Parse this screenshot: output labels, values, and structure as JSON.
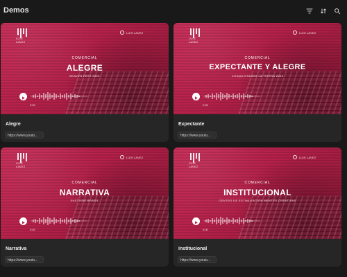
{
  "header": {
    "title": "Demos",
    "tools": [
      {
        "name": "filter-icon"
      },
      {
        "name": "sort-icon"
      },
      {
        "name": "search-icon"
      }
    ]
  },
  "cards": [
    {
      "thumb": {
        "kicker": "COMERCIAL",
        "headline": "ALEGRE",
        "sub": "BEAVEN FEST 2024",
        "time": "0:00"
      },
      "name": "Alegre",
      "link": "https://www.youtu..."
    },
    {
      "thumb": {
        "kicker": "COMERCIAL",
        "headline": "EXPECTANTE Y ALEGRE",
        "sub": "CONQUISTANDO LA TIERRA 2024",
        "time": "0:00"
      },
      "name": "Expectante",
      "link": "https://www.youtu..."
    },
    {
      "thumb": {
        "kicker": "COMERCIAL",
        "headline": "NARRATIVA",
        "sub": "SKETVIDE BRASIL",
        "time": "0:00"
      },
      "name": "Narrativa",
      "link": "https://www.youtu..."
    },
    {
      "thumb": {
        "kicker": "COMERCIAL",
        "headline": "INSTITUCIONAL",
        "sub": "CENTRO DE ESTIMULACIÓN MENTES CREATIVAS",
        "time": "0:00"
      },
      "name": "Institucional",
      "link": "https://www.youtu..."
    }
  ],
  "brand": {
    "left_logo_text": "LUIS LAVEZ",
    "right_logo_text": "LUIS LAVEZ",
    "accent": "#b7274f",
    "card_bg": "#262626",
    "page_bg": "#191919"
  }
}
